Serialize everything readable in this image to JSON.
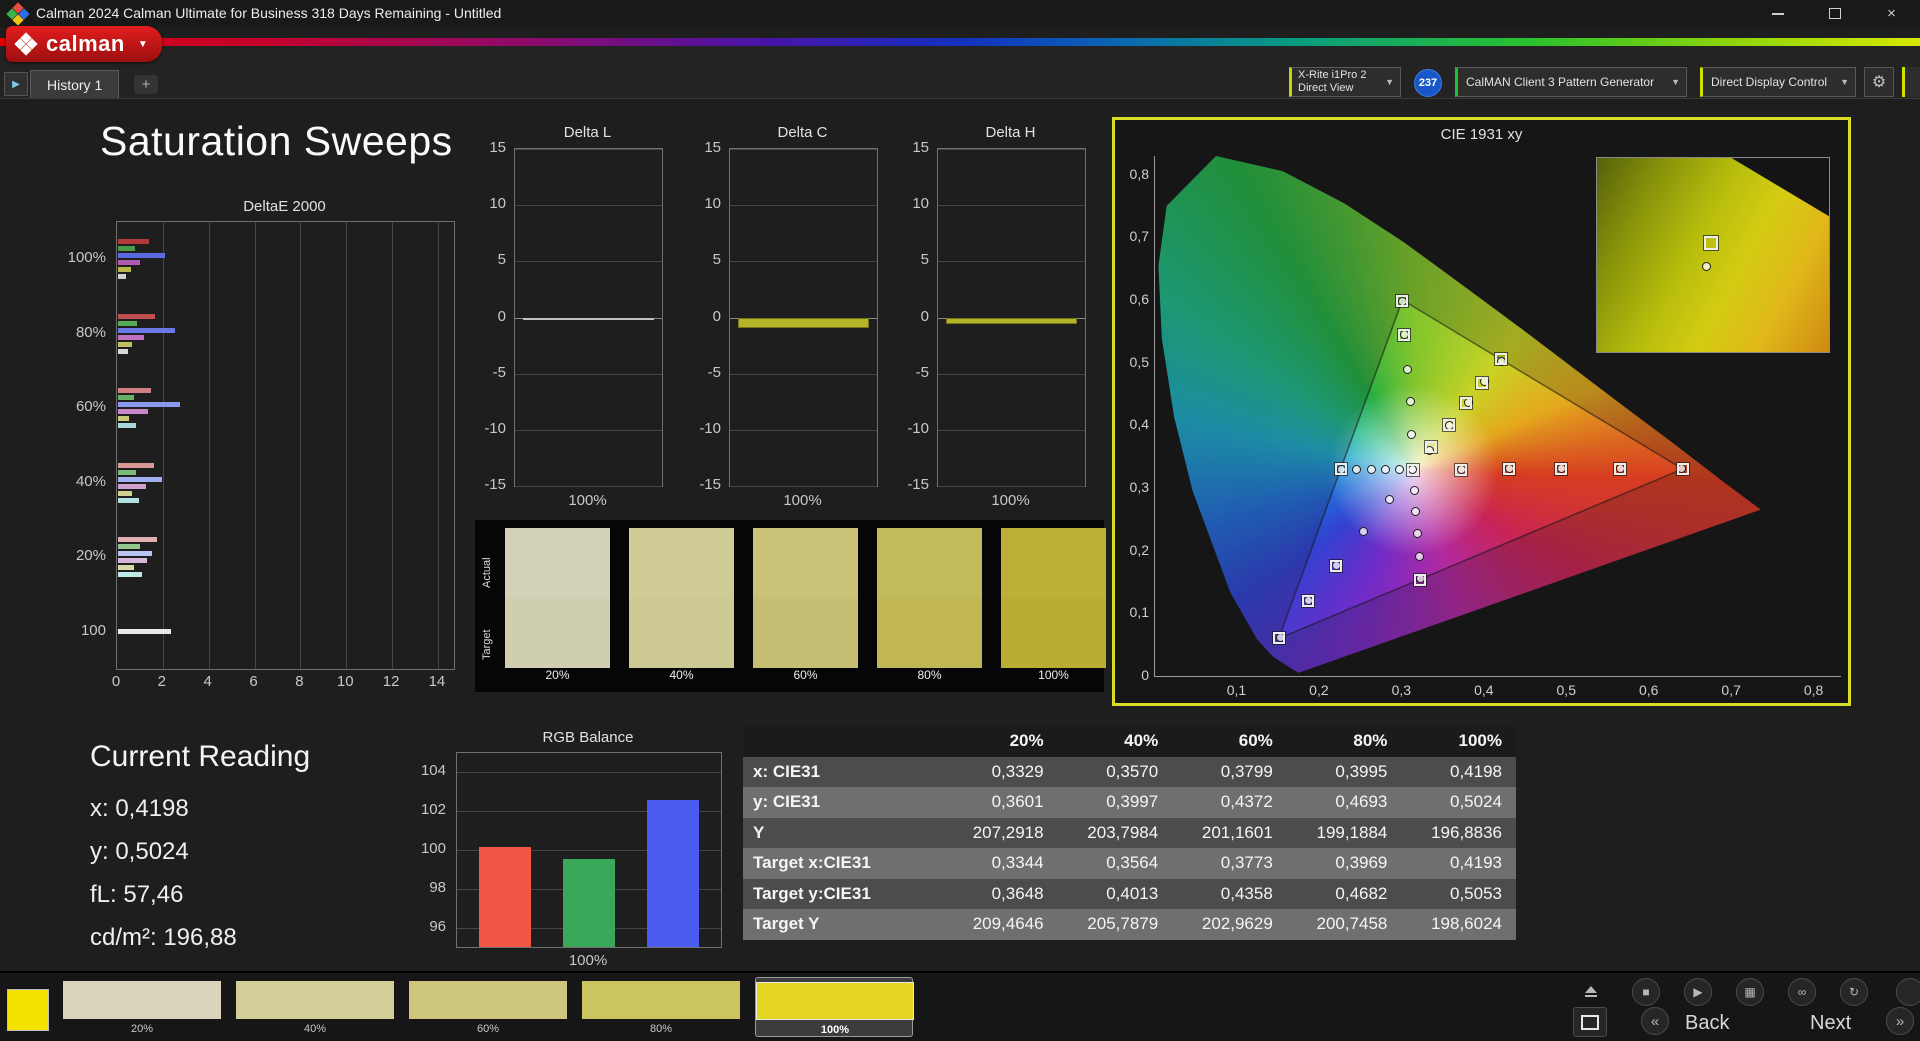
{
  "window": {
    "title": "Calman 2024 Calman Ultimate for Business 318 Days Remaining  - Untitled"
  },
  "logo": {
    "text": "calman"
  },
  "toolbar": {
    "tab_label": "History 1",
    "meter_line1": "X-Rite i1Pro 2",
    "meter_line2": "Direct View",
    "meter_badge": "237",
    "pattern_generator_label": "CalMAN Client 3 Pattern Generator",
    "display_control_label": "Direct Display Control"
  },
  "icons": {
    "dropdown": "▼",
    "plus": "+",
    "close": "×",
    "gear": "⚙",
    "history_arrow": "▶",
    "stop": "■",
    "play": "▶",
    "save": "▦",
    "link": "∞",
    "refresh": "↻",
    "back_chevron": "«",
    "next_chevron": "»"
  },
  "page_title": "Saturation Sweeps",
  "current_reading": {
    "title": "Current Reading",
    "x": "x: 0,4198",
    "y": "y: 0,5024",
    "fl": "fL: 57,46",
    "cdm2": "cd/m²: 196,88"
  },
  "chart_data": [
    {
      "id": "delta_e_2000",
      "type": "bar",
      "orientation": "horizontal",
      "title": "DeltaE 2000",
      "xmax": 14.7,
      "xticks": [
        0,
        2,
        4,
        6,
        8,
        10,
        12,
        14
      ],
      "groups": [
        {
          "label": "100%",
          "bars": [
            {
              "color": "#b23a3a",
              "value": 1.35
            },
            {
              "color": "#4a9a4a",
              "value": 0.75
            },
            {
              "color": "#5a6ae0",
              "value": 2.05
            },
            {
              "color": "#b05ab0",
              "value": 0.95
            },
            {
              "color": "#b8b84a",
              "value": 0.55
            },
            {
              "color": "#d0d0d0",
              "value": 0.35
            }
          ]
        },
        {
          "label": "80%",
          "bars": [
            {
              "color": "#c05050",
              "value": 1.6
            },
            {
              "color": "#58a858",
              "value": 0.85
            },
            {
              "color": "#6a78e8",
              "value": 2.5
            },
            {
              "color": "#c070c0",
              "value": 1.15
            },
            {
              "color": "#c0c060",
              "value": 0.6
            },
            {
              "color": "#d8d8d8",
              "value": 0.45
            }
          ]
        },
        {
          "label": "60%",
          "bars": [
            {
              "color": "#d08080",
              "value": 1.45
            },
            {
              "color": "#68b068",
              "value": 0.7
            },
            {
              "color": "#8a98f0",
              "value": 2.7
            },
            {
              "color": "#c888c8",
              "value": 1.3
            },
            {
              "color": "#c8c878",
              "value": 0.5
            },
            {
              "color": "#a8d8d8",
              "value": 0.8
            }
          ]
        },
        {
          "label": "40%",
          "bars": [
            {
              "color": "#d89898",
              "value": 1.55
            },
            {
              "color": "#78b878",
              "value": 0.8
            },
            {
              "color": "#a0b0f0",
              "value": 1.9
            },
            {
              "color": "#d0a0d0",
              "value": 1.2
            },
            {
              "color": "#d0d090",
              "value": 0.6
            },
            {
              "color": "#b0e0e0",
              "value": 0.9
            }
          ]
        },
        {
          "label": "20%",
          "bars": [
            {
              "color": "#e0b0b0",
              "value": 1.7
            },
            {
              "color": "#90c890",
              "value": 0.95
            },
            {
              "color": "#b8c4f4",
              "value": 1.5
            },
            {
              "color": "#d8b8d8",
              "value": 1.25
            },
            {
              "color": "#d8d8a8",
              "value": 0.7
            },
            {
              "color": "#c0e8e8",
              "value": 1.05
            }
          ]
        },
        {
          "label": "100",
          "bars": [
            {
              "color": "#e8e8e8",
              "value": 2.3
            }
          ]
        }
      ]
    },
    {
      "id": "delta_l",
      "type": "bar",
      "title": "Delta L",
      "x_label": "100%",
      "ymin": -15,
      "ymax": 15,
      "yticks": [
        15,
        10,
        5,
        0,
        -5,
        -10,
        -15
      ],
      "value": -0.15,
      "color": "#1a1a1a",
      "border_color": "#c0c0c0"
    },
    {
      "id": "delta_c",
      "type": "bar",
      "title": "Delta C",
      "x_label": "100%",
      "ymin": -15,
      "ymax": 15,
      "yticks": [
        15,
        10,
        5,
        0,
        -5,
        -10,
        -15
      ],
      "value": -0.95,
      "color": "#b4b428",
      "border_color": "#74741c"
    },
    {
      "id": "delta_h",
      "type": "bar",
      "title": "Delta H",
      "x_label": "100%",
      "ymin": -15,
      "ymax": 15,
      "yticks": [
        15,
        10,
        5,
        0,
        -5,
        -10,
        -15
      ],
      "value": -0.55,
      "color": "#b4b428",
      "border_color": "#74741c"
    },
    {
      "id": "rgb_balance",
      "type": "bar",
      "title": "RGB Balance",
      "x_label": "100%",
      "ymin": 95,
      "ymax": 105,
      "yticks": [
        104,
        102,
        100,
        98,
        96
      ],
      "series": [
        {
          "name": "Red",
          "color": "#f05545",
          "value": 100.15
        },
        {
          "name": "Green",
          "color": "#3aa85a",
          "value": 99.55
        },
        {
          "name": "Blue",
          "color": "#4b5bf0",
          "value": 102.6
        }
      ]
    },
    {
      "id": "cie_1931_xy",
      "type": "scatter",
      "title": "CIE 1931 xy",
      "xmax": 0.832,
      "ymax": 0.83,
      "xticks": [
        {
          "v": 0.1,
          "label": "0,1"
        },
        {
          "v": 0.2,
          "label": "0,2"
        },
        {
          "v": 0.3,
          "label": "0,3"
        },
        {
          "v": 0.4,
          "label": "0,4"
        },
        {
          "v": 0.5,
          "label": "0,5"
        },
        {
          "v": 0.6,
          "label": "0,6"
        },
        {
          "v": 0.7,
          "label": "0,7"
        },
        {
          "v": 0.8,
          "label": "0,8"
        }
      ],
      "yticks": [
        {
          "v": 0.8,
          "label": "0,8"
        },
        {
          "v": 0.7,
          "label": "0,7"
        },
        {
          "v": 0.6,
          "label": "0,6"
        },
        {
          "v": 0.5,
          "label": "0,5"
        },
        {
          "v": 0.4,
          "label": "0,4"
        },
        {
          "v": 0.3,
          "label": "0,3"
        },
        {
          "v": 0.2,
          "label": "0,2"
        },
        {
          "v": 0.1,
          "label": "0,1"
        },
        {
          "v": 0,
          "label": "0"
        }
      ],
      "measured": [
        [
          0.3127,
          0.329
        ],
        [
          0.3329,
          0.3601
        ],
        [
          0.357,
          0.3997
        ],
        [
          0.3799,
          0.4372
        ],
        [
          0.3995,
          0.4693
        ],
        [
          0.4198,
          0.5024
        ],
        [
          0.372,
          0.33
        ],
        [
          0.43,
          0.3305
        ],
        [
          0.493,
          0.3308
        ],
        [
          0.565,
          0.331
        ],
        [
          0.638,
          0.331
        ],
        [
          0.3115,
          0.386
        ],
        [
          0.3095,
          0.438
        ],
        [
          0.306,
          0.49
        ],
        [
          0.303,
          0.545
        ],
        [
          0.3,
          0.598
        ],
        [
          0.284,
          0.281
        ],
        [
          0.253,
          0.231
        ],
        [
          0.22,
          0.176
        ],
        [
          0.186,
          0.12
        ],
        [
          0.152,
          0.062
        ],
        [
          0.2965,
          0.329
        ],
        [
          0.28,
          0.3292
        ],
        [
          0.262,
          0.3294
        ],
        [
          0.244,
          0.3296
        ],
        [
          0.226,
          0.3297
        ],
        [
          0.3145,
          0.2965
        ],
        [
          0.3165,
          0.263
        ],
        [
          0.3185,
          0.2275
        ],
        [
          0.3205,
          0.191
        ],
        [
          0.3215,
          0.155
        ]
      ],
      "targets": [
        [
          0.3127,
          0.329
        ],
        [
          0.3344,
          0.3648
        ],
        [
          0.3564,
          0.4013
        ],
        [
          0.3773,
          0.4358
        ],
        [
          0.3969,
          0.4682
        ],
        [
          0.4193,
          0.5053
        ],
        [
          0.3715,
          0.3295
        ],
        [
          0.4295,
          0.3298
        ],
        [
          0.4925,
          0.33
        ],
        [
          0.5645,
          0.3302
        ],
        [
          0.64,
          0.33
        ],
        [
          0.3025,
          0.545
        ],
        [
          0.2995,
          0.599
        ],
        [
          0.2195,
          0.1755
        ],
        [
          0.1855,
          0.1195
        ],
        [
          0.15,
          0.06
        ],
        [
          0.2255,
          0.3297
        ],
        [
          0.3215,
          0.154
        ]
      ],
      "inset": {
        "square": [
          0.49,
          0.44
        ],
        "circle": [
          0.47,
          0.56
        ]
      }
    },
    {
      "id": "results",
      "type": "table",
      "columns": [
        "",
        "20%",
        "40%",
        "60%",
        "80%",
        "100%"
      ],
      "rows": [
        {
          "label": "x: CIE31",
          "values": [
            "0,3329",
            "0,3570",
            "0,3799",
            "0,3995",
            "0,4198"
          ]
        },
        {
          "label": "y: CIE31",
          "values": [
            "0,3601",
            "0,3997",
            "0,4372",
            "0,4693",
            "0,5024"
          ]
        },
        {
          "label": "Y",
          "values": [
            "207,2918",
            "203,7984",
            "201,1601",
            "199,1884",
            "196,8836"
          ]
        },
        {
          "label": "Target x:CIE31",
          "values": [
            "0,3344",
            "0,3564",
            "0,3773",
            "0,3969",
            "0,4193"
          ]
        },
        {
          "label": "Target y:CIE31",
          "values": [
            "0,3648",
            "0,4013",
            "0,4358",
            "0,4682",
            "0,5053"
          ]
        },
        {
          "label": "Target Y",
          "values": [
            "209,4646",
            "205,7879",
            "202,9629",
            "200,7458",
            "198,6024"
          ]
        }
      ]
    }
  ],
  "swatch_panel": {
    "row_labels": [
      "Actual",
      "Target"
    ],
    "levels": [
      {
        "label": "20%",
        "actual": "#d3d1b6",
        "target": "#d0ceb1"
      },
      {
        "label": "40%",
        "actual": "#d0cc98",
        "target": "#cdc993"
      },
      {
        "label": "60%",
        "actual": "#c9c278",
        "target": "#c6bf73"
      },
      {
        "label": "80%",
        "actual": "#c3ba59",
        "target": "#c0b754"
      },
      {
        "label": "100%",
        "actual": "#bcb138",
        "target": "#b9ae33"
      }
    ]
  },
  "bottom_bar": {
    "patch_color": "#f4e100",
    "levels": [
      {
        "label": "20%",
        "color": "#d8d5ba",
        "selected": false
      },
      {
        "label": "40%",
        "color": "#d4cf9a",
        "selected": false
      },
      {
        "label": "60%",
        "color": "#ccc57c",
        "selected": false
      },
      {
        "label": "80%",
        "color": "#ccc45e",
        "selected": false
      },
      {
        "label": "100%",
        "color": "#e4d622",
        "selected": true
      }
    ],
    "back_label": "Back",
    "next_label": "Next"
  }
}
